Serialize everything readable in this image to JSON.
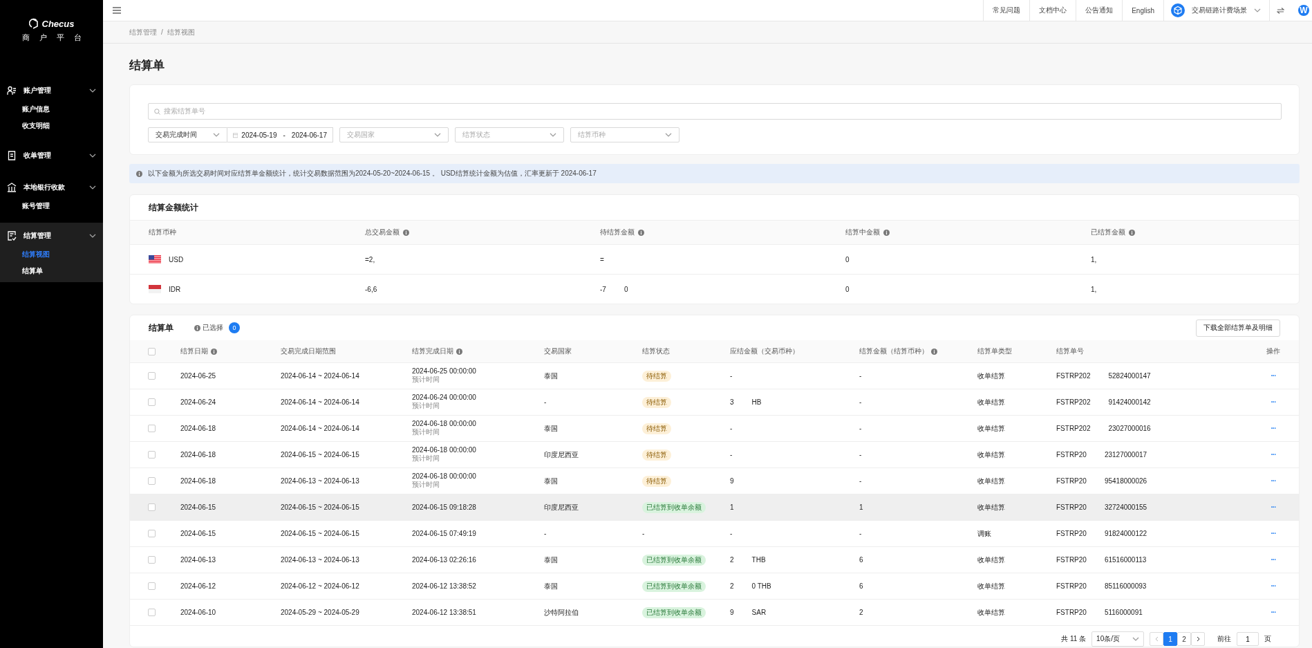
{
  "sidebar": {
    "logo": "Checus",
    "subtitle": "商户平台",
    "groups": [
      {
        "label": "账户管理",
        "selected": false,
        "items": [
          {
            "label": "账户信息",
            "selected": false
          },
          {
            "label": "收支明细",
            "selected": false
          }
        ]
      },
      {
        "label": "收单管理",
        "selected": false
      },
      {
        "label": "本地银行收款",
        "selected": false,
        "items": [
          {
            "label": "账号管理",
            "selected": false
          }
        ]
      },
      {
        "label": "结算管理",
        "selected": true,
        "items": [
          {
            "label": "结算视图",
            "selected": true
          },
          {
            "label": "结算单",
            "selected": false
          }
        ]
      }
    ]
  },
  "topbar": {
    "links": [
      "常见问题",
      "文档中心",
      "公告通知",
      "English"
    ],
    "scene": "交易链路计费场景",
    "avatar": "W"
  },
  "breadcrumb": {
    "items": [
      "结算管理",
      "结算视图"
    ],
    "separator": "/"
  },
  "page_title": "结算单",
  "filters": {
    "search_placeholder": "搜索结算单号",
    "time_type": "交易完成时间",
    "date_start": "2024-05-19",
    "date_separator": "-",
    "date_end": "2024-06-17",
    "selects": [
      {
        "placeholder": "交易国家"
      },
      {
        "placeholder": "结算状态"
      },
      {
        "placeholder": "结算币种"
      }
    ]
  },
  "notice": "以下金额为所选交易时间对应结算单金额统计，统计交易数据范围为2024-05-20~2024-06-15 。 USD结算统计金额为估值，汇率更新于 2024-06-17",
  "stats": {
    "title": "结算金额统计",
    "columns": [
      {
        "label": "结算币种",
        "info": false
      },
      {
        "label": "总交易金额",
        "info": true
      },
      {
        "label": "待结算金额",
        "info": true
      },
      {
        "label": "结算中金额",
        "info": true
      },
      {
        "label": "已结算金额",
        "info": true
      }
    ],
    "rows": [
      {
        "currency": "USD",
        "kind": "us",
        "values": [
          [
            "=2,"
          ],
          [
            "="
          ],
          [
            "0"
          ],
          [
            "1,"
          ]
        ]
      },
      {
        "currency": "IDR",
        "kind": "id",
        "values": [
          [
            "-6,6"
          ],
          [
            "-7",
            "0"
          ],
          [
            "0"
          ],
          [
            "1,"
          ]
        ]
      }
    ]
  },
  "orders": {
    "title": "结算单",
    "selected_label": "已选择",
    "selected_count": "0",
    "download": "下载全部结算单及明细",
    "select_all_checked": false,
    "columns": [
      {
        "label": "结算日期",
        "info": true
      },
      {
        "label": "交易完成日期范围",
        "info": false
      },
      {
        "label": "结算完成日期",
        "info": true
      },
      {
        "label": "交易国家",
        "info": false
      },
      {
        "label": "结算状态",
        "info": false
      },
      {
        "label": "应结金额（交易币种）",
        "info": false
      },
      {
        "label": "结算金额（结算币种）",
        "info": true
      },
      {
        "label": "结算单类型",
        "info": false
      },
      {
        "label": "结算单号",
        "info": false
      },
      {
        "label": "操作",
        "info": false
      }
    ],
    "rows": [
      {
        "checked": false,
        "highlighted": false,
        "date": "2024-06-25",
        "range": "2024-06-14 ~ 2024-06-14",
        "done": "2024-06-25 00:00:00",
        "done_note": "预计时间",
        "country": "泰国",
        "status": "待结算",
        "kind": "pending",
        "amount": [
          "-"
        ],
        "settled": "-",
        "type": "收单结算",
        "no": [
          "FSTRP202",
          "52824000147"
        ],
        "action": "···"
      },
      {
        "checked": false,
        "highlighted": false,
        "date": "2024-06-24",
        "range": "2024-06-14 ~ 2024-06-14",
        "done": "2024-06-24 00:00:00",
        "done_note": "预计时间",
        "country": "-",
        "status": "待结算",
        "kind": "pending",
        "amount": [
          "3",
          "HB"
        ],
        "settled": "-",
        "type": "收单结算",
        "no": [
          "FSTRP202",
          "91424000142"
        ],
        "action": "···"
      },
      {
        "checked": false,
        "highlighted": false,
        "date": "2024-06-18",
        "range": "2024-06-14 ~ 2024-06-14",
        "done": "2024-06-18 00:00:00",
        "done_note": "预计时间",
        "country": "泰国",
        "status": "待结算",
        "kind": "pending",
        "amount": [
          "-"
        ],
        "settled": "-",
        "type": "收单结算",
        "no": [
          "FSTRP202",
          "23027000016"
        ],
        "action": "···"
      },
      {
        "checked": false,
        "highlighted": false,
        "date": "2024-06-18",
        "range": "2024-06-15 ~ 2024-06-15",
        "done": "2024-06-18 00:00:00",
        "done_note": "预计时间",
        "country": "印度尼西亚",
        "status": "待结算",
        "kind": "pending",
        "amount": [
          "-"
        ],
        "settled": "-",
        "type": "收单结算",
        "no": [
          "FSTRP20",
          "23127000017"
        ],
        "action": "···"
      },
      {
        "checked": false,
        "highlighted": false,
        "date": "2024-06-18",
        "range": "2024-06-13 ~ 2024-06-13",
        "done": "2024-06-18 00:00:00",
        "done_note": "预计时间",
        "country": "泰国",
        "status": "待结算",
        "kind": "pending",
        "amount": [
          "9"
        ],
        "settled": "-",
        "type": "收单结算",
        "no": [
          "FSTRP20",
          "95418000026"
        ],
        "action": "···"
      },
      {
        "checked": false,
        "highlighted": true,
        "date": "2024-06-15",
        "range": "2024-06-15 ~ 2024-06-15",
        "done": "2024-06-15 09:18:28",
        "country": "印度尼西亚",
        "status": "已结算到收单余额",
        "kind": "settled",
        "amount": [
          "1"
        ],
        "settled": "1",
        "type": "收单结算",
        "no": [
          "FSTRP20",
          "32724000155"
        ],
        "action": "···"
      },
      {
        "checked": false,
        "highlighted": false,
        "date": "2024-06-15",
        "range": "2024-06-15 ~ 2024-06-15",
        "done": "2024-06-15 07:49:19",
        "country": "-",
        "status": "-",
        "kind": "plain",
        "amount": [
          "-"
        ],
        "settled": "-",
        "type": "调账",
        "no": [
          "FSTRP20",
          "91824000122"
        ],
        "action": "···"
      },
      {
        "checked": false,
        "highlighted": false,
        "date": "2024-06-13",
        "range": "2024-06-13 ~ 2024-06-13",
        "done": "2024-06-13 02:26:16",
        "country": "泰国",
        "status": "已结算到收单余额",
        "kind": "settled",
        "amount": [
          "2",
          "THB"
        ],
        "settled": "6",
        "type": "收单结算",
        "no": [
          "FSTRP20",
          "61516000113"
        ],
        "action": "···"
      },
      {
        "checked": false,
        "highlighted": false,
        "date": "2024-06-12",
        "range": "2024-06-12 ~ 2024-06-12",
        "done": "2024-06-12 13:38:52",
        "country": "泰国",
        "status": "已结算到收单余额",
        "kind": "settled",
        "amount": [
          "2",
          "0 THB"
        ],
        "settled": "6",
        "type": "收单结算",
        "no": [
          "FSTRP20",
          "85116000093"
        ],
        "action": "···"
      },
      {
        "checked": false,
        "highlighted": false,
        "date": "2024-06-10",
        "range": "2024-05-29 ~ 2024-05-29",
        "done": "2024-06-12 13:38:51",
        "country": "沙特阿拉伯",
        "status": "已结算到收单余额",
        "kind": "settled",
        "amount": [
          "9",
          "SAR"
        ],
        "settled": "2",
        "type": "收单结算",
        "no": [
          "FSTRP20",
          "5116000091"
        ],
        "action": "···"
      }
    ],
    "pagination": {
      "total": "共 11 条",
      "page_size": "10条/页",
      "pages": [
        {
          "label": "1",
          "selected": true
        },
        {
          "label": "2",
          "selected": false
        }
      ],
      "goto_label": "前往",
      "goto_value": "1",
      "unit": "页"
    }
  }
}
